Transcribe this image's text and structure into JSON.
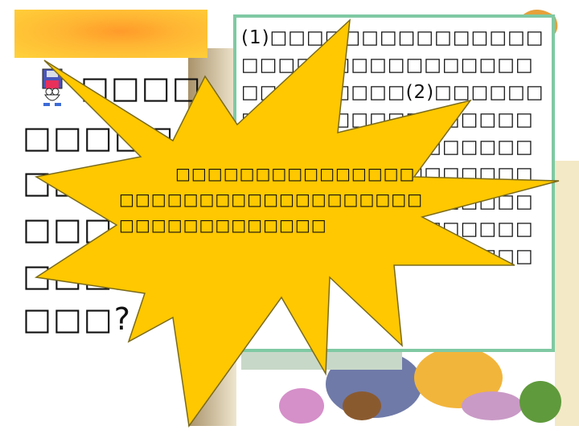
{
  "slide": {
    "left_lines": [
      "□□□□",
      "□□□□□",
      "□□□□□",
      "□□□□□",
      "□□□□□",
      "□□□?"
    ],
    "right_paragraph": "(1)□□□□□□□□□□□□□□□□□□□□□□□□□□□□□□□□□□□□□□□□(2)□□□□□□□□□□□□□□□□□□□□□□□□□□□□□□□□□□□□□□□□□□□□□□□□□□□□□□□□□□□□□□□□□□□□□□□□□□□□□□□□□□□□□□□□□□□□□□□□□□□□□□□",
    "burst_text": "□□□□□□□□□□□□□□□□□□□□□□□□□□□□□□□□□□□□□□□□□□□□□□□"
  },
  "colors": {
    "burst_fill": "#ffc800",
    "burst_stroke": "#7a6a1a",
    "panel_border": "#7fc9a3",
    "banner": "#ffa733"
  },
  "icons": [
    "floppy-disk-mascot-icon"
  ]
}
